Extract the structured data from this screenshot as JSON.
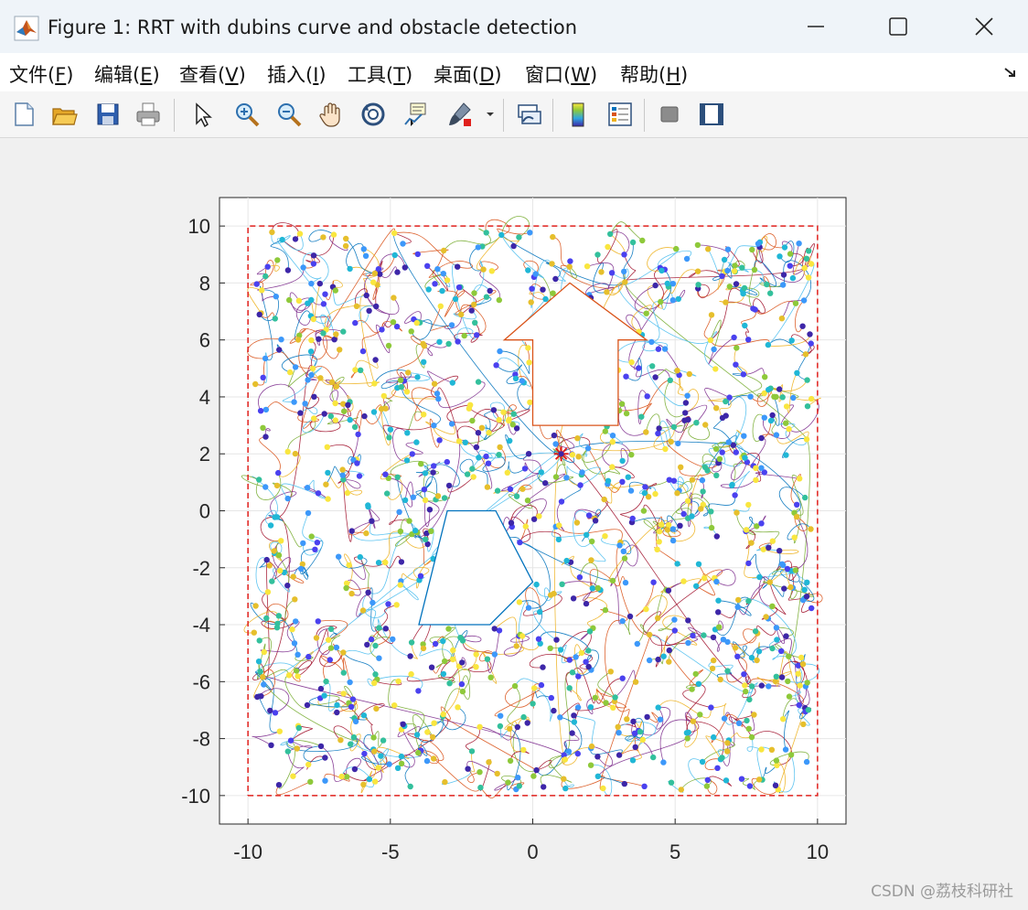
{
  "window": {
    "title": "Figure 1: RRT with dubins curve and obstacle detection",
    "controls": {
      "minimize": "minimize",
      "maximize": "maximize",
      "close": "close"
    }
  },
  "menu": {
    "items": [
      {
        "label": "文件(",
        "key": "F",
        "end": ")"
      },
      {
        "label": "编辑(",
        "key": "E",
        "end": ")"
      },
      {
        "label": "查看(",
        "key": "V",
        "end": ")"
      },
      {
        "label": "插入(",
        "key": "I",
        "end": ")"
      },
      {
        "label": "工具(",
        "key": "T",
        "end": ")"
      },
      {
        "label": "桌面(",
        "key": "D",
        "end": ")"
      },
      {
        "label": "窗口(",
        "key": "W",
        "end": ")"
      },
      {
        "label": "帮助(",
        "key": "H",
        "end": ")"
      }
    ]
  },
  "toolbar": {
    "icons": [
      "new-figure-icon",
      "open-icon",
      "save-icon",
      "print-icon",
      "select-arrow-icon",
      "zoom-in-icon",
      "zoom-out-icon",
      "pan-hand-icon",
      "rotate-3d-icon",
      "data-cursor-icon",
      "brush-icon",
      "link-plot-icon",
      "colorbar-icon",
      "legend-icon",
      "hide-plot-tools-icon",
      "show-plot-tools-icon"
    ]
  },
  "chart_data": {
    "type": "scatter",
    "title": "",
    "xlabel": "",
    "ylabel": "",
    "xlim": [
      -11,
      11
    ],
    "ylim": [
      -11,
      11
    ],
    "xticks": [
      -10,
      -5,
      0,
      5,
      10
    ],
    "yticks": [
      -10,
      -8,
      -6,
      -4,
      -2,
      0,
      2,
      4,
      6,
      8,
      10
    ],
    "grid": true,
    "boundary": {
      "x": [
        -10,
        10,
        10,
        -10,
        -10
      ],
      "y": [
        -10,
        -10,
        10,
        10,
        -10
      ],
      "color": "#e0201c",
      "style": "dashed"
    },
    "obstacles": [
      {
        "name": "arrow",
        "color": "#d95319",
        "x": [
          1.3,
          4,
          3,
          3,
          0,
          0,
          -1,
          1.3
        ],
        "y": [
          8,
          6,
          6,
          3,
          3,
          6,
          6,
          8
        ]
      },
      {
        "name": "pentagon",
        "color": "#0072bd",
        "x": [
          -3,
          -1.3,
          0,
          -1.5,
          -4,
          -3
        ],
        "y": [
          0,
          0,
          -2.5,
          -4,
          -4,
          0
        ]
      }
    ],
    "start": {
      "x": 1,
      "y": 2,
      "color": "#e0201c",
      "marker": "*"
    },
    "tree_colors": [
      "#0072bd",
      "#d95319",
      "#edb120",
      "#7e2f8e",
      "#77ac30",
      "#4dbeee",
      "#a2142f"
    ],
    "node_colors": [
      "#3d26a8",
      "#4a41ef",
      "#3c98fa",
      "#20b7d6",
      "#33c09c",
      "#8ec93a",
      "#e6bf2c",
      "#f9e63f"
    ],
    "node_count": 1000,
    "seed": 41
  },
  "watermark": "CSDN @荔枝科研社"
}
